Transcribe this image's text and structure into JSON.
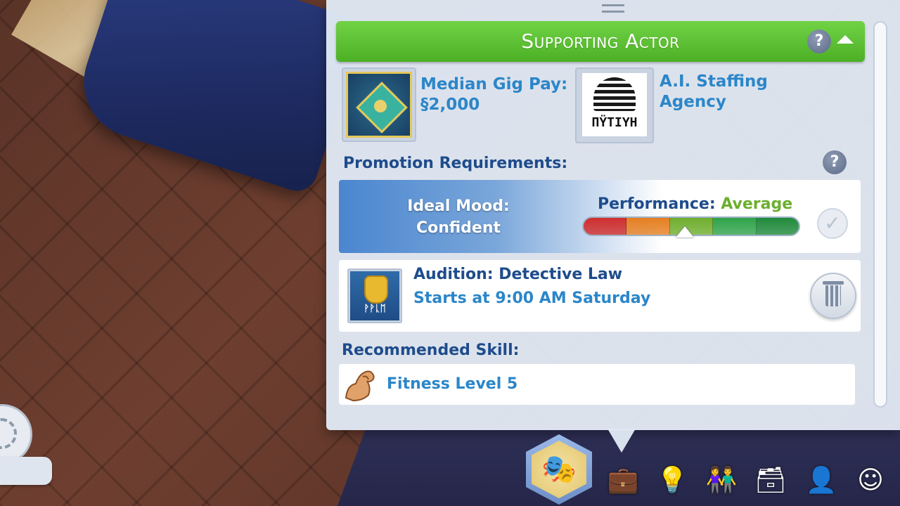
{
  "panel": {
    "title": "Supporting Actor",
    "help_glyph": "?",
    "gig": {
      "label_line1": "Median Gig Pay:",
      "label_line2": "§2,000"
    },
    "agency": {
      "name_line1": "A.I. Staffing",
      "name_line2": "Agency",
      "logo_glyphs": "ΠŸΤΙΥΗ"
    },
    "promotion": {
      "heading": "Promotion Requirements:",
      "mood_label": "Ideal Mood:",
      "mood_value": "Confident",
      "performance_label": "Performance:",
      "performance_value": "Average",
      "performance_level": 0.47,
      "performance_segments": [
        "#cf2e2e",
        "#e57f22",
        "#6fae2e",
        "#2fa34a",
        "#1f8a3b"
      ]
    },
    "audition": {
      "title": "Audition: Detective Law",
      "time": "Starts at 9:00  AM Saturday",
      "badge_glyphs": "ᚹᚹᚳᛖ"
    },
    "skill": {
      "heading": "Recommended Skill:",
      "label": "Fitness Level 5"
    }
  },
  "colors": {
    "title_green": "#5cc236",
    "heading_navy": "#1e4c8c",
    "link_blue": "#2b86c9",
    "average_green": "#6cae2e"
  },
  "toolbar": {
    "icons": [
      "career-masks-icon",
      "briefcase-icon",
      "lightbulb-icon",
      "relationships-icon",
      "inventory-icon",
      "sim-head-icon",
      "aspiration-icon"
    ]
  }
}
